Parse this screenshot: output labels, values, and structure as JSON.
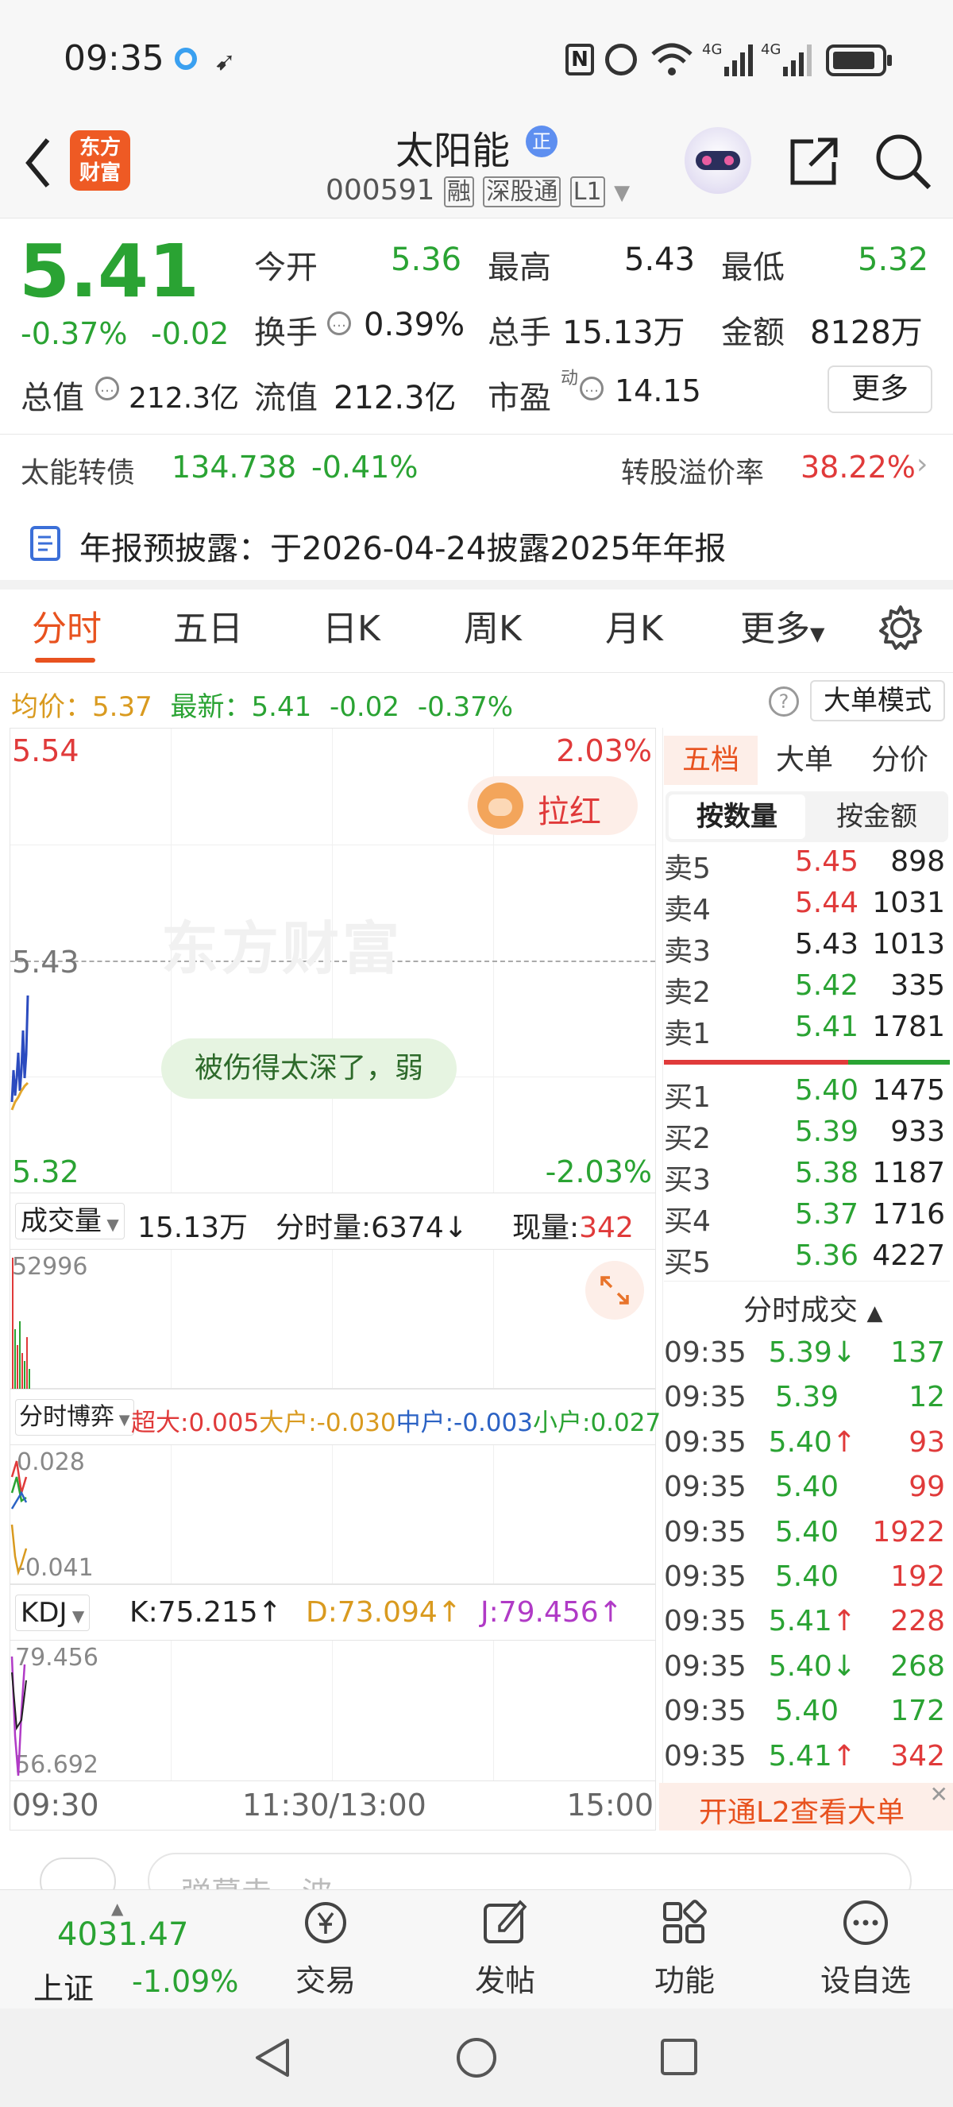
{
  "status_bar": {
    "time": "09:35"
  },
  "header": {
    "logo_line1": "东方",
    "logo_line2": "财富",
    "stock_name": "太阳能",
    "name_badge": "正",
    "code": "000591",
    "tags": [
      "融",
      "深股通",
      "L1"
    ]
  },
  "quote": {
    "price": "5.41",
    "change_pct": "-0.37%",
    "change": "-0.02",
    "open_label": "今开",
    "open": "5.36",
    "high_label": "最高",
    "high": "5.43",
    "low_label": "最低",
    "low": "5.32",
    "turnover_label": "换手",
    "turnover": "0.39%",
    "volume_label": "总手",
    "volume": "15.13万",
    "amount_label": "金额",
    "amount": "8128万",
    "mktcap_label": "总值",
    "mktcap": "212.3亿",
    "float_label": "流值",
    "float": "212.3亿",
    "pe_label": "市盈",
    "pe_sup": "动",
    "pe": "14.15",
    "more_label": "更多"
  },
  "bond": {
    "name": "太能转债",
    "price": "134.738",
    "change": "-0.41%",
    "premium_label": "转股溢价率",
    "premium": "38.22%"
  },
  "notice": {
    "text": "年报预披露：于2026-04-24披露2025年年报"
  },
  "tabs": [
    "分时",
    "五日",
    "日K",
    "周K",
    "月K",
    "更多"
  ],
  "chart_header": {
    "avg_label": "均价：",
    "avg": "5.37",
    "last_label": "最新：",
    "last": "5.41",
    "chg": "-0.02",
    "pct": "-0.37%",
    "mode_label": "大单模式"
  },
  "main_chart": {
    "top_price": "5.54",
    "top_pct": "2.03%",
    "mid_price": "5.43",
    "bottom_price": "5.32",
    "bottom_pct": "-2.03%",
    "watermark": "东方财富",
    "lahong_label": "拉红",
    "comment": "被伤得太深了，弱"
  },
  "volume_panel": {
    "selector": "成交量",
    "total": "15.13万",
    "tick_label": "分时量:",
    "tick": "6374",
    "now_label": "现量:",
    "now": "342",
    "axis_max": "52996"
  },
  "game_panel": {
    "selector": "分时博弈",
    "super_label": "超大:",
    "super": "0.005",
    "large_label": "大户:",
    "large": "-0.030",
    "mid_label": "中户:",
    "mid": "-0.003",
    "small_label": "小户:",
    "small": "0.027",
    "axis_top": "0.028",
    "axis_bottom": "-0.041"
  },
  "kdj_panel": {
    "selector": "KDJ",
    "k": "K:75.215",
    "d": "D:73.094",
    "j": "J:79.456",
    "axis_top": "79.456",
    "axis_bottom": "56.692"
  },
  "time_axis": {
    "start": "09:30",
    "mid": "11:30/13:00",
    "end": "15:00"
  },
  "orderbook": {
    "tabs": [
      "五档",
      "大单",
      "分价"
    ],
    "subtabs": [
      "按数量",
      "按金额"
    ],
    "asks": [
      {
        "label": "卖5",
        "price": "5.45",
        "qty": "898"
      },
      {
        "label": "卖4",
        "price": "5.44",
        "qty": "1031"
      },
      {
        "label": "卖3",
        "price": "5.43",
        "qty": "1013"
      },
      {
        "label": "卖2",
        "price": "5.42",
        "qty": "335"
      },
      {
        "label": "卖1",
        "price": "5.41",
        "qty": "1781"
      }
    ],
    "bids": [
      {
        "label": "买1",
        "price": "5.40",
        "qty": "1475"
      },
      {
        "label": "买2",
        "price": "5.39",
        "qty": "933"
      },
      {
        "label": "买3",
        "price": "5.38",
        "qty": "1187"
      },
      {
        "label": "买4",
        "price": "5.37",
        "qty": "1716"
      },
      {
        "label": "买5",
        "price": "5.36",
        "qty": "4227"
      }
    ],
    "ask_colors": [
      "#e03a3a",
      "#e03a3a",
      "#222222",
      "#2aa333",
      "#2aa333"
    ],
    "bid_colors": [
      "#2aa333",
      "#2aa333",
      "#2aa333",
      "#2aa333",
      "#2aa333"
    ]
  },
  "trades": {
    "title": "分时成交",
    "rows": [
      {
        "time": "09:35",
        "price": "5.39",
        "arrow": "↓",
        "qty": "137",
        "qcolor": "#2aa333"
      },
      {
        "time": "09:35",
        "price": "5.39",
        "arrow": "",
        "qty": "12",
        "qcolor": "#2aa333"
      },
      {
        "time": "09:35",
        "price": "5.40",
        "arrow": "↑",
        "qty": "93",
        "qcolor": "#e03a3a"
      },
      {
        "time": "09:35",
        "price": "5.40",
        "arrow": "",
        "qty": "99",
        "qcolor": "#e03a3a"
      },
      {
        "time": "09:35",
        "price": "5.40",
        "arrow": "",
        "qty": "1922",
        "qcolor": "#e03a3a"
      },
      {
        "time": "09:35",
        "price": "5.40",
        "arrow": "",
        "qty": "192",
        "qcolor": "#e03a3a"
      },
      {
        "time": "09:35",
        "price": "5.41",
        "arrow": "↑",
        "qty": "228",
        "qcolor": "#e03a3a"
      },
      {
        "time": "09:35",
        "price": "5.40",
        "arrow": "↓",
        "qty": "268",
        "qcolor": "#2aa333"
      },
      {
        "time": "09:35",
        "price": "5.40",
        "arrow": "",
        "qty": "172",
        "qcolor": "#2aa333"
      },
      {
        "time": "09:35",
        "price": "5.41",
        "arrow": "↑",
        "qty": "342",
        "qcolor": "#e03a3a"
      }
    ],
    "l2_label": "开通L2查看大单"
  },
  "comment_input": {
    "placeholder": "弹幕走一波"
  },
  "bottom_nav": {
    "index_value": "4031.47",
    "index_name": "上证",
    "index_pct": "-1.09%",
    "items": [
      "交易",
      "发帖",
      "功能",
      "设自选"
    ]
  }
}
